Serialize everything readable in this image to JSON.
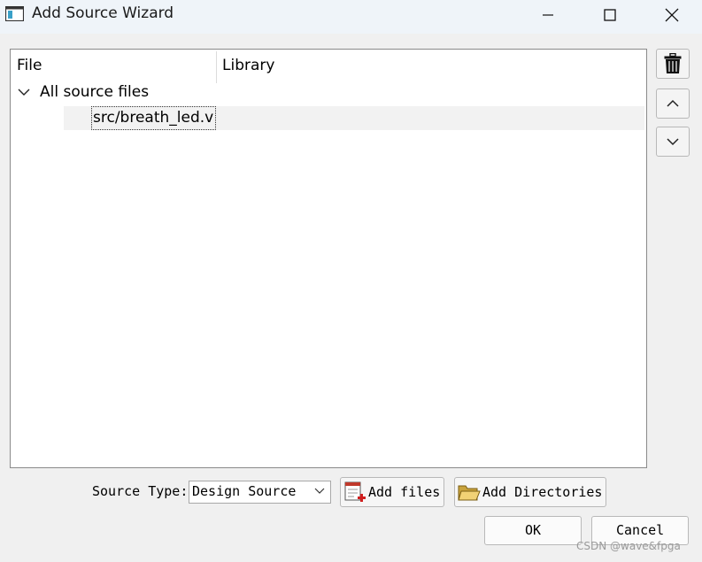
{
  "window": {
    "title": "Add Source Wizard",
    "controls": [
      "minimize-icon",
      "maximize-icon",
      "close-icon"
    ]
  },
  "tree": {
    "columns": [
      "File",
      "Library"
    ],
    "group": {
      "label": "All source files",
      "expanded": true
    },
    "files": [
      {
        "name": "src/breath_led.v",
        "library": ""
      }
    ]
  },
  "side_buttons": [
    "trash-icon",
    "move-up-icon",
    "move-down-icon"
  ],
  "bottom": {
    "source_type_label": "Source Type:",
    "source_type_value": "Design Source",
    "add_files_label": "Add files",
    "add_dirs_label": "Add Directories"
  },
  "dialog_buttons": {
    "ok": "OK",
    "cancel": "Cancel"
  },
  "watermark": "CSDN @wave&fpga"
}
